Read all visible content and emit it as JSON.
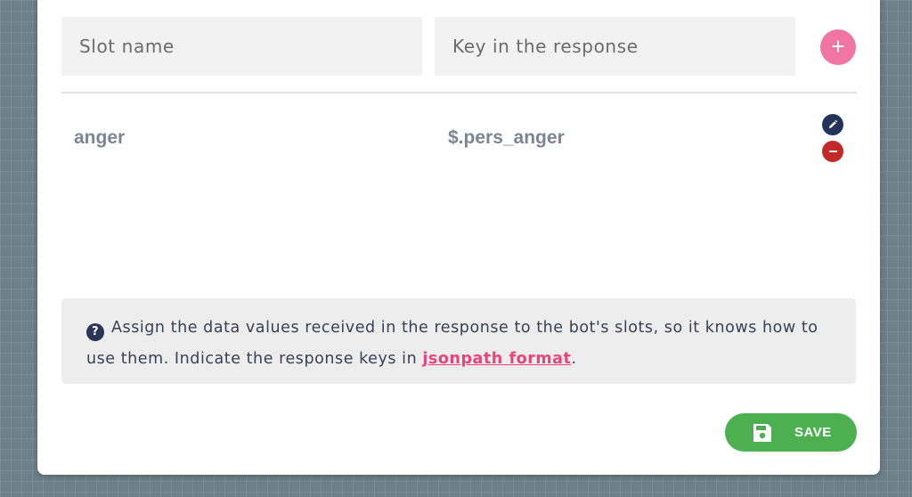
{
  "form": {
    "slot_name_placeholder": "Slot name",
    "key_placeholder": "Key in the response",
    "slot_name_value": "",
    "key_value": ""
  },
  "actions": {
    "add_icon": "plus-icon",
    "save_label": "SAVE",
    "save_icon": "floppy-disk-icon"
  },
  "mappings": [
    {
      "slot": "anger",
      "key": "$.pers_anger",
      "edit_icon": "pencil-icon",
      "remove_icon": "minus-icon"
    }
  ],
  "info": {
    "icon": "question-circle-icon",
    "text_before": "Assign the data values received in the response to the bot's slots, so it knows how to use them. Indicate the response keys in ",
    "link_text": "jsonpath format",
    "text_after": "."
  },
  "colors": {
    "add_button": "#f075a0",
    "edit_button": "#24335a",
    "remove_button": "#c22a2a",
    "save_button": "#4caf50",
    "link": "#e8447b",
    "row_text": "#7c8596"
  }
}
